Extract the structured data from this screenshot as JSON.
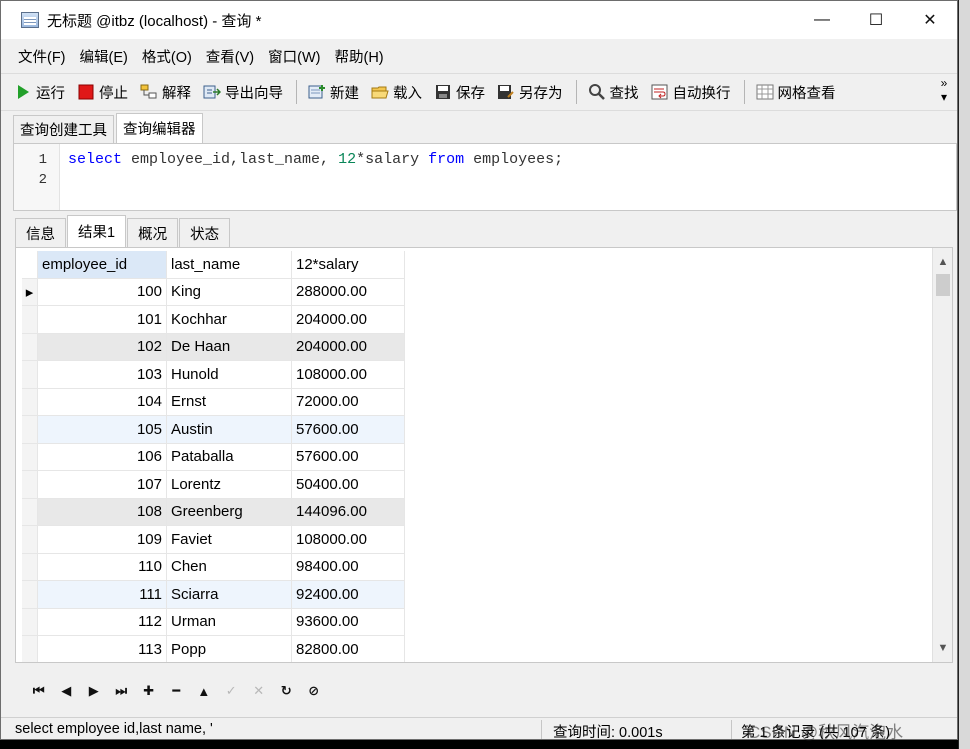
{
  "window": {
    "title": "无标题 @itbz (localhost) - 查询 *",
    "minimize": "—",
    "maximize": "☐",
    "close": "✕"
  },
  "menu": [
    "文件(F)",
    "编辑(E)",
    "格式(O)",
    "查看(V)",
    "窗口(W)",
    "帮助(H)"
  ],
  "toolbar": {
    "run": "运行",
    "stop": "停止",
    "explain": "解释",
    "export_wizard": "导出向导",
    "new": "新建",
    "load": "载入",
    "save": "保存",
    "save_as": "另存为",
    "find": "查找",
    "word_wrap": "自动换行",
    "grid_view": "网格查看",
    "more_top": "»",
    "more_bottom": "▾"
  },
  "editor_tabs": [
    "查询创建工具",
    "查询编辑器"
  ],
  "editor": {
    "line_numbers": [
      "1",
      "2"
    ],
    "sql": {
      "kw_select": "select",
      "cols": " employee_id,last_name, ",
      "number": "12",
      "expr": "*salary ",
      "kw_from": "from",
      "table": " employees;"
    }
  },
  "result_tabs": [
    "信息",
    "结果1",
    "概况",
    "状态"
  ],
  "grid": {
    "columns": [
      "employee_id",
      "last_name",
      "12*salary"
    ],
    "rows": [
      [
        "100",
        "King",
        "288000.00"
      ],
      [
        "101",
        "Kochhar",
        "204000.00"
      ],
      [
        "102",
        "De Haan",
        "204000.00"
      ],
      [
        "103",
        "Hunold",
        "108000.00"
      ],
      [
        "104",
        "Ernst",
        "72000.00"
      ],
      [
        "105",
        "Austin",
        "57600.00"
      ],
      [
        "106",
        "Pataballa",
        "57600.00"
      ],
      [
        "107",
        "Lorentz",
        "50400.00"
      ],
      [
        "108",
        "Greenberg",
        "144096.00"
      ],
      [
        "109",
        "Faviet",
        "108000.00"
      ],
      [
        "110",
        "Chen",
        "98400.00"
      ],
      [
        "111",
        "Sciarra",
        "92400.00"
      ],
      [
        "112",
        "Urman",
        "93600.00"
      ],
      [
        "113",
        "Popp",
        "82800.00"
      ]
    ],
    "current_row_marker": "▸"
  },
  "nav": {
    "first": "⏮",
    "prev": "◀",
    "next": "▶",
    "last": "⏭",
    "add": "✚",
    "delete": "━",
    "apply": "▲",
    "confirm": "✓",
    "cancel": "✕",
    "refresh": "↻",
    "stop": "⊘"
  },
  "status": {
    "sql_preview": "select employee id,last name, '",
    "query_time": "查询时间: 0.001s",
    "records": "第 1 条记录 (共 107 条)"
  },
  "watermark": "CSDN @秋风汽泡水",
  "colors": {
    "keyword": "#0000ff",
    "number": "#098658",
    "header_highlight": "#dbe8f7",
    "run_green": "#22a02a",
    "stop_red": "#e01818"
  }
}
